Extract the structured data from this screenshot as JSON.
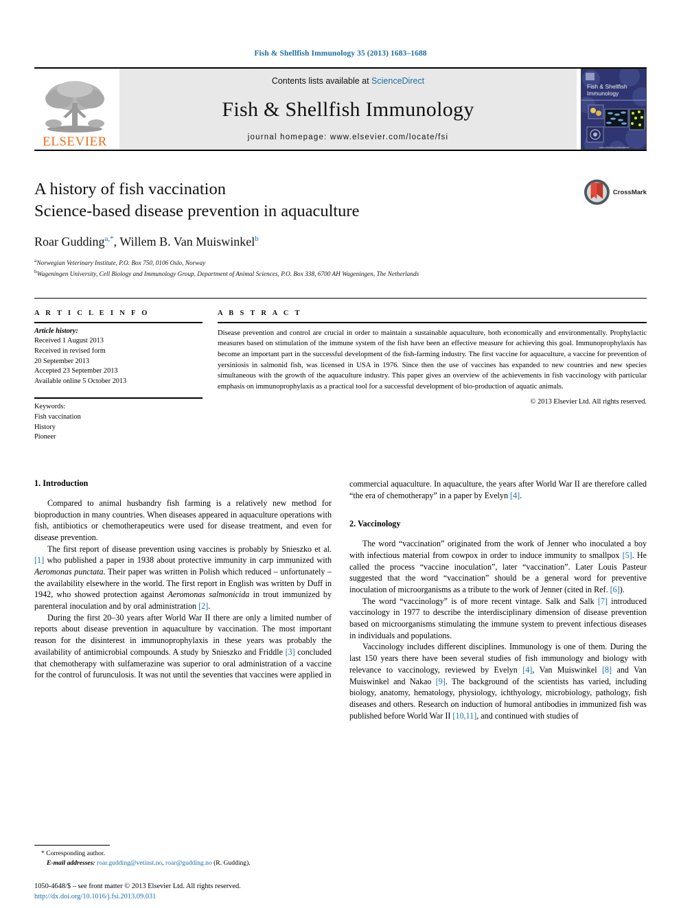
{
  "running_head": "Fish & Shellfish Immunology 35 (2013) 1683–1688",
  "masthead": {
    "publisher_word": "ELSEVIER",
    "contents_prefix": "Contents lists available at ",
    "contents_link": "ScienceDirect",
    "journal_title": "Fish & Shellfish Immunology",
    "homepage": "journal homepage: www.elsevier.com/locate/fsi",
    "cover_title_line1": "Fish & Shellfish",
    "cover_title_line2": "Immunology"
  },
  "article": {
    "title_line1": "A history of fish vaccination",
    "title_line2": "Science-based disease prevention in aquaculture",
    "authors": "Roar Gudding",
    "author_sup_1": "a,*",
    "authors_2": ", Willem B. Van Muiswinkel",
    "author_sup_2": "b",
    "affiliation_a_sup": "a",
    "affiliation_a": "Norwegian Veterinary Institute, P.O. Box 750, 0106 Oslo, Norway",
    "affiliation_b_sup": "b",
    "affiliation_b": "Wageningen University, Cell Biology and Immunology Group, Department of Animal Sciences, P.O. Box 338, 6700 AH Wageningen, The Netherlands",
    "crossmark_label": "CrossMark"
  },
  "info": {
    "heading": "A R T I C L E   I N F O",
    "history_label": "Article history:",
    "history_lines": [
      "Received 1 August 2013",
      "Received in revised form",
      "20 September 2013",
      "Accepted 23 September 2013",
      "Available online 5 October 2013"
    ],
    "keywords_label": "Keywords:",
    "keywords": [
      "Fish vaccination",
      "History",
      "Pioneer"
    ]
  },
  "abstract": {
    "heading": "A B S T R A C T",
    "text": "Disease prevention and control are crucial in order to maintain a sustainable aquaculture, both economically and environmentally. Prophylactic measures based on stimulation of the immune system of the fish have been an effective measure for achieving this goal. Immunoprophylaxis has become an important part in the successful development of the fish-farming industry. The first vaccine for aquaculture, a vaccine for prevention of yersiniosis in salmonid fish, was licensed in USA in 1976. Since then the use of vaccines has expanded to new countries and new species simultaneous with the growth of the aquaculture industry. This paper gives an overview of the achievements in fish vaccinology with particular emphasis on immunoprophylaxis as a practical tool for a successful development of bio-production of aquatic animals.",
    "copyright": "© 2013 Elsevier Ltd. All rights reserved."
  },
  "sections": {
    "intro_heading": "1. Introduction",
    "vaccinology_heading": "2. Vaccinology"
  },
  "left_column": {
    "p1": "Compared to animal husbandry fish farming is a relatively new method for bioproduction in many countries. When diseases appeared in aquaculture operations with fish, antibiotics or chemotherapeutics were used for disease treatment, and even for disease prevention.",
    "p2_a": "The first report of disease prevention using vaccines is probably by Snieszko et al. ",
    "p2_ref1": "[1]",
    "p2_b": " who published a paper in 1938 about protective immunity in carp immunized with ",
    "p2_ital1": "Aeromonas punctata",
    "p2_c": ". Their paper was written in Polish which reduced – unfortunately – the availability elsewhere in the world. The first report in English was written by Duff in 1942, who showed protection against ",
    "p2_ital2": "Aeromonas salmonicida",
    "p2_d": " in trout immunized by parenteral inoculation and by oral administration ",
    "p2_ref2": "[2]",
    "p2_e": ".",
    "p3_a": "During the first 20–30 years after World War II there are only a limited number of reports about disease prevention in aquaculture by vaccination. The most important reason for the disinterest in immunoprophylaxis in these years was probably the availability of antimicrobial compounds. A study by Snieszko and Friddle ",
    "p3_ref": "[3]",
    "p3_b": " concluded that chemotherapy with sulfamerazine was superior to oral administration of a vaccine for the control of furunculosis. It was not until the seventies that vaccines were applied in"
  },
  "right_column": {
    "p1_a": "commercial aquaculture. In aquaculture, the years after World War II are therefore called “the era of chemotherapy” in a paper by Evelyn ",
    "p1_ref": "[4]",
    "p1_b": ".",
    "p2_a": "The word “vaccination” originated from the work of Jenner who inoculated a boy with infectious material from cowpox in order to induce immunity to smallpox ",
    "p2_ref1": "[5]",
    "p2_b": ". He called the process “vaccine inoculation”, later “vaccination”. Later Louis Pasteur suggested that the word “vaccination” should be a general word for preventive inoculation of microorganisms as a tribute to the work of Jenner (cited in Ref. ",
    "p2_ref2": "[6]",
    "p2_c": ").",
    "p3_a": "The word “vaccinology” is of more recent vintage. Salk and Salk ",
    "p3_ref": "[7]",
    "p3_b": " introduced vaccinology in 1977 to describe the interdisciplinary dimension of disease prevention based on microorganisms stimulating the immune system to prevent infectious diseases in individuals and populations.",
    "p4_a": "Vaccinology includes different disciplines. Immunology is one of them. During the last 150 years there have been several studies of fish immunology and biology with relevance to vaccinology, reviewed by Evelyn ",
    "p4_ref1": "[4]",
    "p4_b": ", Van Muiswinkel ",
    "p4_ref2": "[8]",
    "p4_c": " and Van Muiswinkel and Nakao ",
    "p4_ref3": "[9]",
    "p4_d": ". The background of the scientists has varied, including biology, anatomy, hematology, physiology, ichthyology, microbiology, pathology, fish diseases and others. Research on induction of humoral antibodies in immunized fish was published before World War II ",
    "p4_ref4": "[10,11]",
    "p4_e": ", and continued with studies of"
  },
  "footnotes": {
    "corresponding": "* Corresponding author.",
    "email_label": "E-mail addresses:",
    "email_1": "roar.gudding@vetinst.no",
    "email_sep": ", ",
    "email_2": "roar@gudding.no",
    "email_suffix": " (R. Gudding)."
  },
  "footer": {
    "front_matter": "1050-4648/$ – see front matter © 2013 Elsevier Ltd. All rights reserved.",
    "doi": "http://dx.doi.org/10.1016/j.fsi.2013.09.031"
  },
  "colors": {
    "link_blue": "#1a6ea5",
    "elsevier_orange": "#E9711C",
    "masthead_gray": "#e8e8e8",
    "cover_navy": "#2a2f66"
  }
}
